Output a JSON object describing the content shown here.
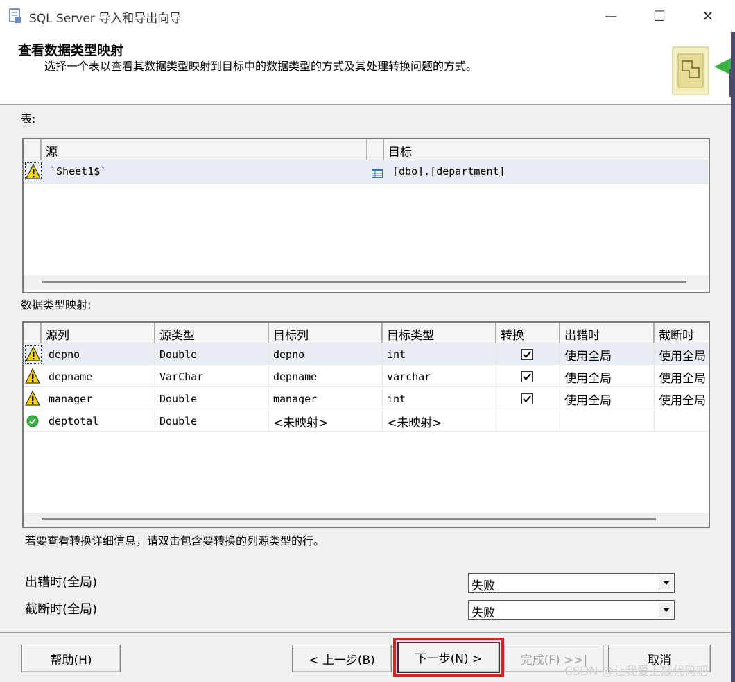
{
  "window": {
    "title": "SQL Server 导入和导出向导",
    "minimize_glyph": "—",
    "maximize_glyph": "☐",
    "close_glyph": "✕"
  },
  "header": {
    "title": "查看数据类型映射",
    "description": "选择一个表以查看其数据类型映射到目标中的数据类型的方式及其处理转换问题的方式。"
  },
  "tables": {
    "label": "表:",
    "columns": [
      "源",
      "目标"
    ],
    "rows": [
      {
        "status_icon": "warning-icon",
        "source": "`Sheet1$`",
        "dest_icon": "table-icon",
        "target": "[dbo].[department]"
      }
    ]
  },
  "mapping": {
    "label": "数据类型映射:",
    "columns": [
      "源列",
      "源类型",
      "目标列",
      "目标类型",
      "转换",
      "出错时",
      "截断时"
    ],
    "rows": [
      {
        "status_icon": "warning-icon",
        "source_column": "depno",
        "source_type": "Double",
        "target_column": "depno",
        "target_type": "int",
        "convert": true,
        "on_error": "使用全局",
        "on_truncation": "使用全局"
      },
      {
        "status_icon": "warning-icon",
        "source_column": "depname",
        "source_type": "VarChar",
        "target_column": "depname",
        "target_type": "varchar",
        "convert": true,
        "on_error": "使用全局",
        "on_truncation": "使用全局"
      },
      {
        "status_icon": "warning-icon",
        "source_column": "manager",
        "source_type": "Double",
        "target_column": "manager",
        "target_type": "int",
        "convert": true,
        "on_error": "使用全局",
        "on_truncation": "使用全局"
      },
      {
        "status_icon": "ok-icon",
        "source_column": "deptotal",
        "source_type": "Double",
        "target_column": "<未映射>",
        "target_type": "<未映射>",
        "convert": false,
        "on_error": "",
        "on_truncation": ""
      }
    ]
  },
  "hint": "若要查看转换详细信息，请双击包含要转换的列源类型的行。",
  "global": {
    "on_error_label": "出错时(全局)",
    "on_error_value": "失败",
    "on_truncation_label": "截断时(全局)",
    "on_truncation_value": "失败"
  },
  "buttons": {
    "help": "帮助(H)",
    "back": "< 上一步(B)",
    "next": "下一步(N) >",
    "finish": "完成(F) >>|",
    "cancel": "取消"
  },
  "watermark": "CSDN @让我爱上敲代码吧",
  "colors": {
    "highlight": "#e02020",
    "warning": "#f5d400",
    "ok": "#3cb043"
  }
}
